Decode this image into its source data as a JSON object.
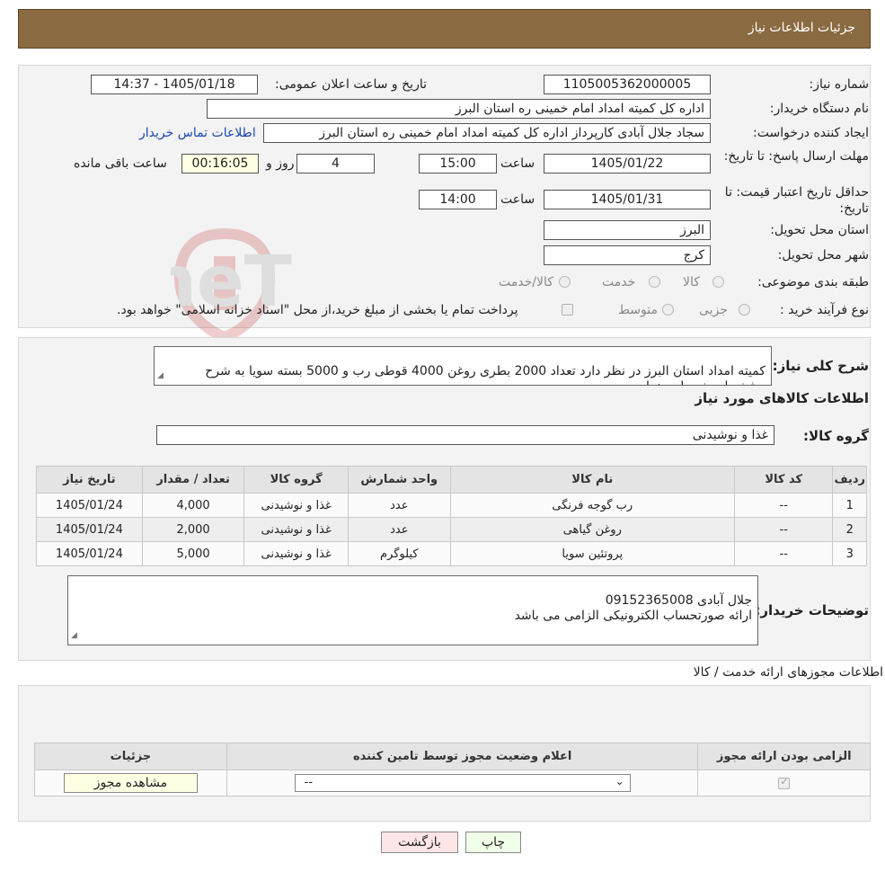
{
  "header": {
    "title": "جزئیات اطلاعات نیاز"
  },
  "form": {
    "need_number_label": "شماره نیاز:",
    "need_number": "1105005362000005",
    "announce_label": "تاریخ و ساعت اعلان عمومی:",
    "announce_value": "1405/01/18 - 14:37",
    "buyer_org_label": "نام دستگاه خریدار:",
    "buyer_org": "اداره کل کمیته امداد امام خمینی  ره  استان البرز",
    "requester_label": "ایجاد کننده درخواست:",
    "requester": "سجاد جلال آبادی کارپرداز اداره کل کمیته امداد امام خمینی  ره  استان البرز",
    "contact_link": "اطلاعات تماس خریدار",
    "deadline_label": "مهلت ارسال پاسخ: تا تاریخ:",
    "deadline_date": "1405/01/22",
    "time_label": "ساعت",
    "deadline_time": "15:00",
    "days": "4",
    "days_label": "روز و",
    "remaining": "00:16:05",
    "remaining_label": "ساعت باقی مانده",
    "validity_label": "حداقل تاریخ اعتبار قیمت: تا تاریخ:",
    "validity_date": "1405/01/31",
    "validity_time": "14:00",
    "province_label": "استان محل تحویل:",
    "province": "البرز",
    "city_label": "شهر محل تحویل:",
    "city": "کرج",
    "category_label": "طبقه بندی موضوعی:",
    "category_options": [
      "کالا",
      "خدمت",
      "کالا/خدمت"
    ],
    "process_label": "نوع فرآیند خرید :",
    "process_options": [
      "جزیی",
      "متوسط"
    ],
    "payment_note": "پرداخت تمام یا بخشی از مبلغ خرید،از محل \"اسناد خزانه اسلامی\" خواهد بود."
  },
  "summary": {
    "label": "شرح کلی نیاز:",
    "text": "کمیته امداد استان البرز در نظر دارد تعداد 2000 بطری روغن 4000 قوطی رب و 5000 بسته سویا به شرح مشخصات خریداری نماید.",
    "goods_info_title": "اطلاعات کالاهای مورد نیاز",
    "group_label": "گروه کالا:",
    "group_value": "غذا و نوشیدنی"
  },
  "items_table": {
    "headers": [
      "ردیف",
      "کد کالا",
      "نام کالا",
      "واحد شمارش",
      "گروه کالا",
      "تعداد / مقدار",
      "تاریخ نیاز"
    ],
    "rows": [
      [
        "1",
        "--",
        "رب گوجه فرنگی",
        "عدد",
        "غذا و نوشیدنی",
        "4,000",
        "1405/01/24"
      ],
      [
        "2",
        "--",
        "روغن گیاهی",
        "عدد",
        "غذا و نوشیدنی",
        "2,000",
        "1405/01/24"
      ],
      [
        "3",
        "--",
        "پروتئین سویا",
        "کیلوگرم",
        "غذا و نوشیدنی",
        "5,000",
        "1405/01/24"
      ]
    ]
  },
  "buyer_notes": {
    "label": "توضیحات خریدار:",
    "text": "جلال آبادی 09152365008\nارائه صورتحساب الکترونیکی الزامی می باشد"
  },
  "licenses": {
    "title": "اطلاعات مجوزهای ارائه خدمت / کالا",
    "headers": [
      "الزامی بودن ارائه مجوز",
      "اعلام وضعیت مجوز توسط تامین کننده",
      "جزئیات"
    ],
    "select_value": "--",
    "view_button": "مشاهده مجوز"
  },
  "actions": {
    "print": "چاپ",
    "back": "بازگشت"
  },
  "watermark": "AriaTender.neT"
}
